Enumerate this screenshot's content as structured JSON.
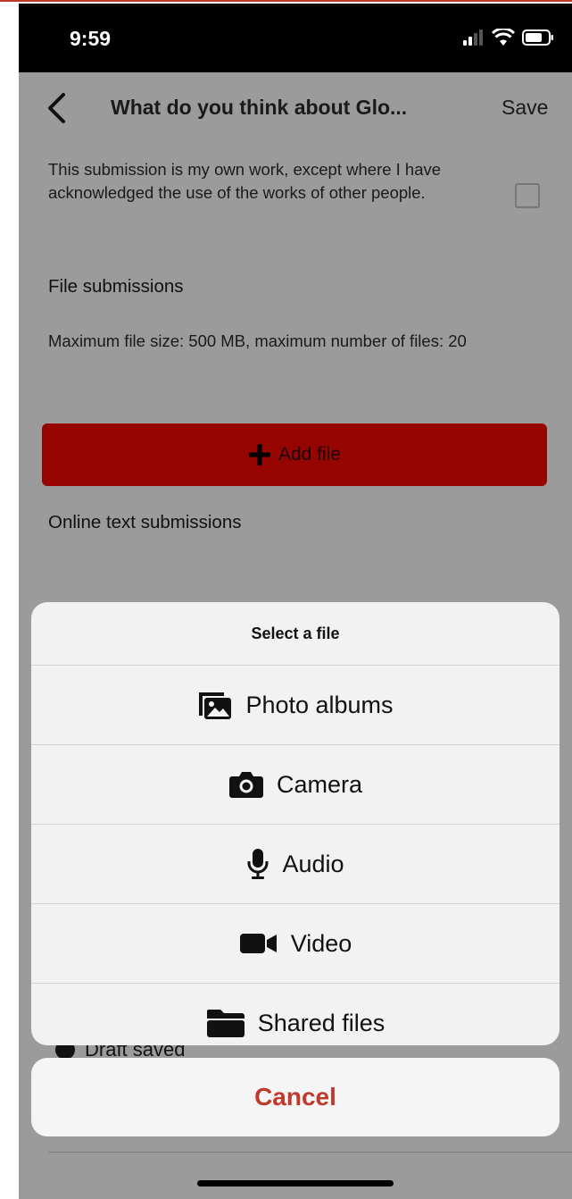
{
  "status_bar": {
    "time": "9:59"
  },
  "nav": {
    "title": "What do you think about Glo...",
    "save_label": "Save"
  },
  "statement": {
    "text": "This submission is my own work, except where I have acknowledged the use of the works of other people."
  },
  "file_submissions": {
    "heading": "File submissions",
    "info": "Maximum file size: 500 MB, maximum number of files: 20",
    "add_file_label": "Add file"
  },
  "online_text": {
    "heading": "Online text submissions"
  },
  "draft": {
    "label": "Draft saved"
  },
  "sheet": {
    "title": "Select a file",
    "items": [
      {
        "label": "Photo albums",
        "icon": "photo-albums-icon"
      },
      {
        "label": "Camera",
        "icon": "camera-icon"
      },
      {
        "label": "Audio",
        "icon": "microphone-icon"
      },
      {
        "label": "Video",
        "icon": "video-icon"
      },
      {
        "label": "Shared files",
        "icon": "folder-icon"
      }
    ],
    "cancel_label": "Cancel"
  },
  "colors": {
    "accent": "#970500",
    "cancel": "#c0392b",
    "overlay": "#9b9b9b"
  }
}
